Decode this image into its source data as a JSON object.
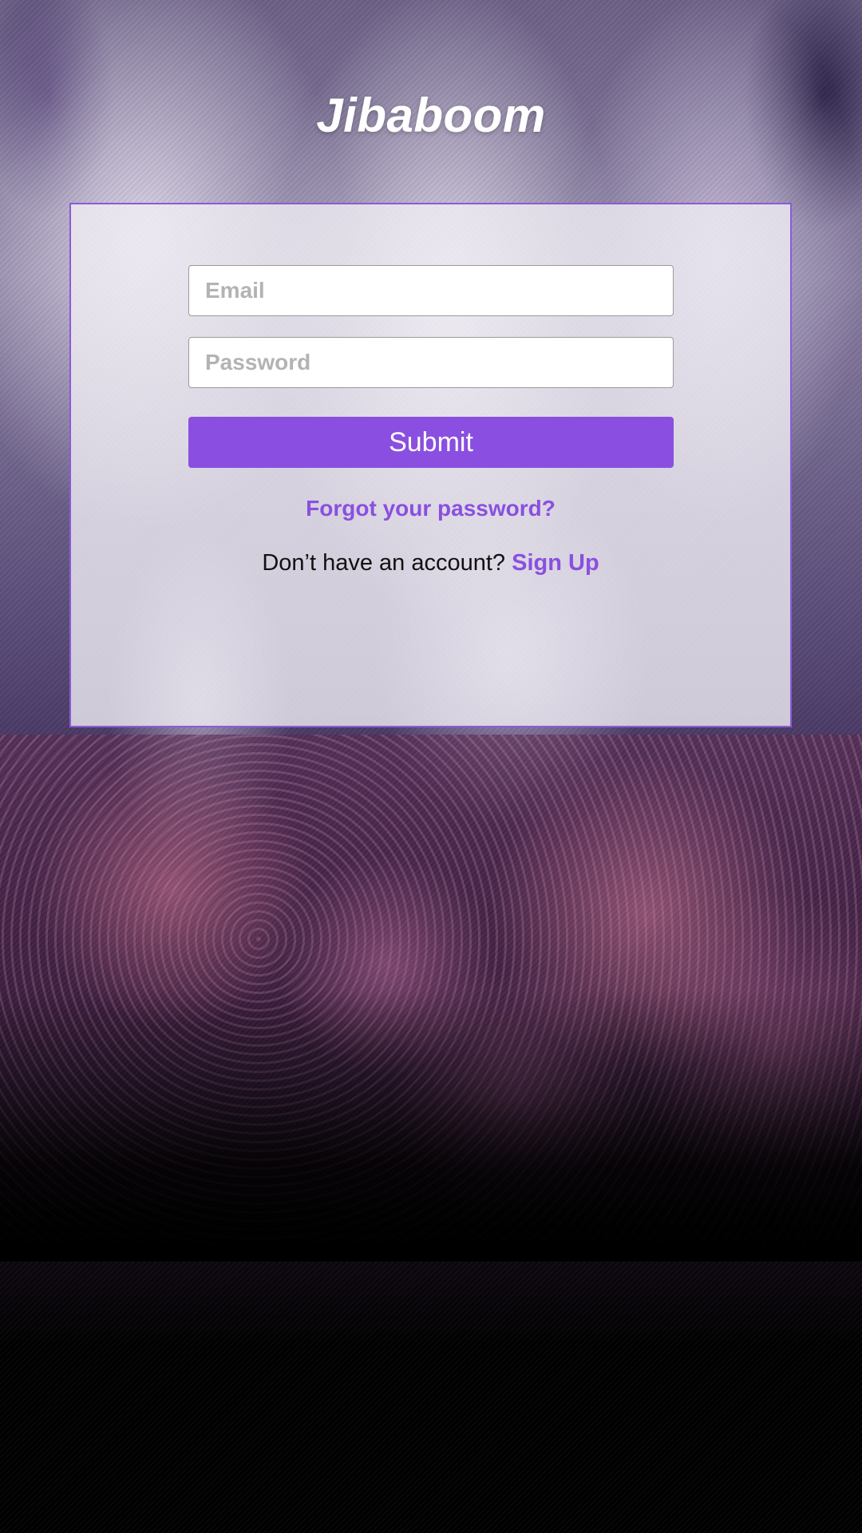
{
  "app": {
    "brand": "Jibaboom"
  },
  "login_form": {
    "email_placeholder": "Email",
    "password_placeholder": "Password",
    "submit_label": "Submit",
    "forgot_password_label": "Forgot your password?",
    "no_account_text": "Don’t have an account?",
    "signup_label": "Sign Up"
  },
  "colors": {
    "accent": "#8a4fe0",
    "card_border": "#8c5ad8",
    "card_background": "#f0eef4",
    "brand_text": "#ffffff"
  },
  "background": {
    "description_icon": "concert-crowd-image"
  }
}
